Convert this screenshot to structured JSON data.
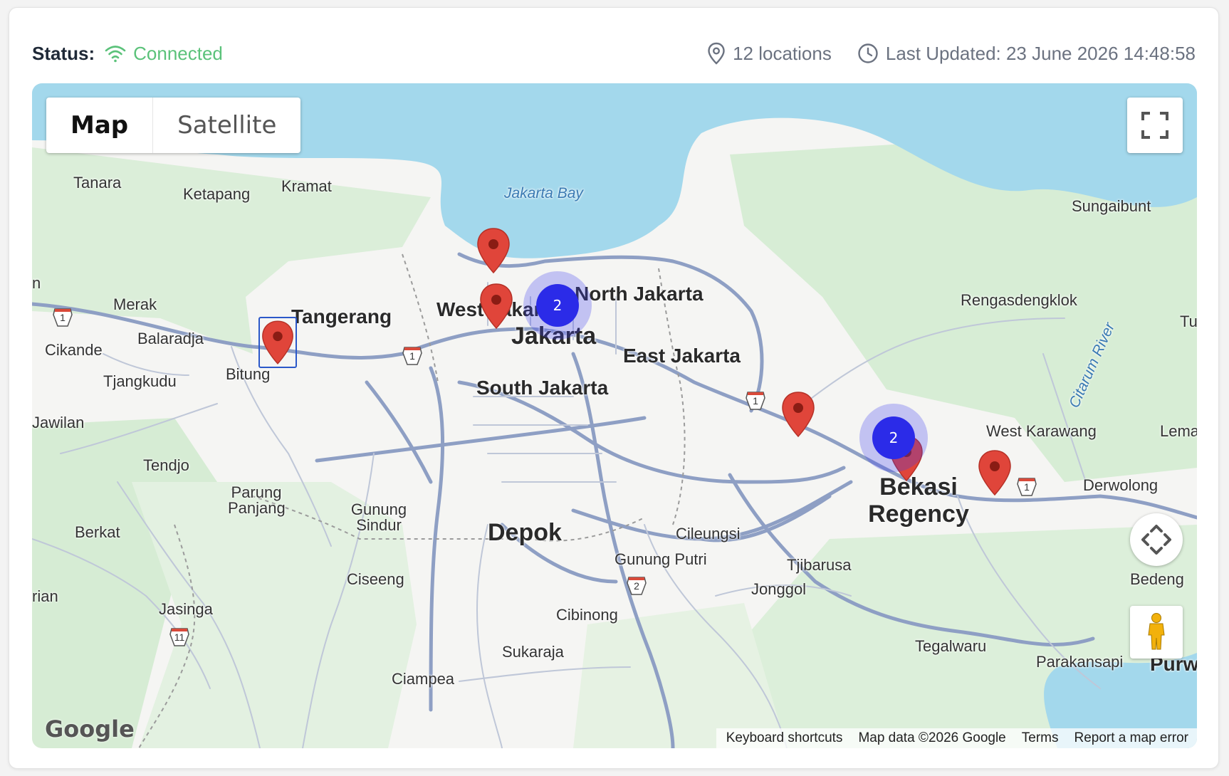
{
  "status": {
    "label": "Status:",
    "value": "Connected",
    "color": "#5bc27a"
  },
  "meta": {
    "locations": "12 locations",
    "last_updated": "Last Updated: 23 June 2026 14:48:58"
  },
  "map": {
    "type_toggle": {
      "map": "Map",
      "satellite": "Satellite",
      "selected": "Map"
    },
    "clusters": [
      {
        "count": "2"
      },
      {
        "count": "2"
      }
    ],
    "place_labels": {
      "tanara": "Tanara",
      "ketapang": "Ketapang",
      "kramat": "Kramat",
      "jakarta_bay": "Jakarta Bay",
      "sungaibunt": "Sungaibunt",
      "merak": "Merak",
      "tangerang": "Tangerang",
      "west_jakarta": "West Jakarta",
      "north_jakarta": "North Jakarta",
      "jakarta": "Jakarta",
      "east_jakarta": "East Jakarta",
      "rengasdengklok": "Rengasdengklok",
      "citarum_river": "Citarum River",
      "cikande": "Cikande",
      "balaradja": "Balaradja",
      "bitung": "Bitung",
      "tjangkudu": "Tjangkudu",
      "south_jakarta": "South Jakarta",
      "jawilan": "Jawilan",
      "west_karawang": "West Karawang",
      "lema": "Lema",
      "tendjo": "Tendjo",
      "parung_panjang": "Parung Panjang",
      "gunung_sindur": "Gunung Sindur",
      "bekasi_regency": "Bekasi Regency",
      "derwolong": "Derwolong",
      "berkat": "Berkat",
      "depok": "Depok",
      "cileungsi": "Cileungsi",
      "gunung_putri": "Gunung Putri",
      "tjibarusa": "Tjibarusa",
      "ciseeng": "Ciseeng",
      "jonggol": "Jonggol",
      "bedeng": "Bedeng",
      "jasinga": "Jasinga",
      "cibinong": "Cibinong",
      "tegalwaru": "Tegalwaru",
      "sukaraja": "Sukaraja",
      "ciampea": "Ciampea",
      "parakansapi": "Parakansapi",
      "purw": "Purw",
      "tu": "Tu",
      "n": "n",
      "rian": "rian"
    },
    "route_shields": {
      "r1": "1",
      "r2": "2",
      "r11": "11"
    },
    "logo": "Google",
    "footer": {
      "shortcuts": "Keyboard shortcuts",
      "data": "Map data ©2026 Google",
      "terms": "Terms",
      "report": "Report a map error"
    },
    "icons": [
      "wifi-icon",
      "location-pin-icon",
      "clock-icon",
      "fullscreen-icon",
      "camera-control-icon",
      "pegman-icon"
    ]
  }
}
